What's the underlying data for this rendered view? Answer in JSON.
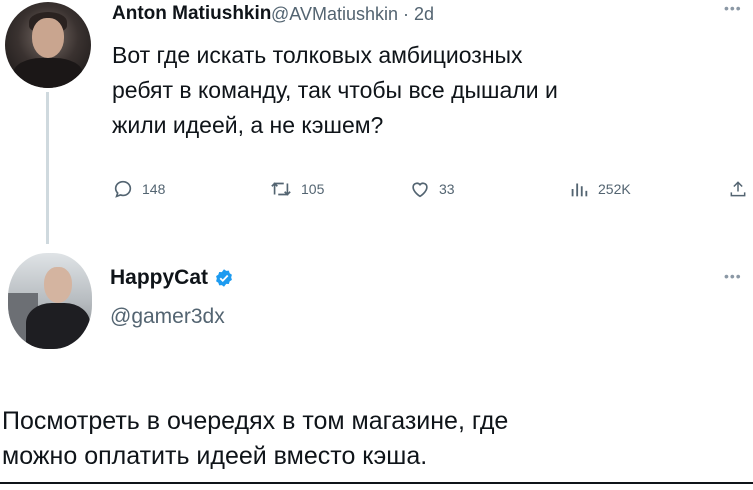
{
  "tweet": {
    "author_name": "Anton Matiushkin",
    "handle_time": "@AVMatiushkin · 2d",
    "text": "Вот где искать толковых амбициозных\nребят в команду, так чтобы все дышали и\nжили идеей, а не кэшем?",
    "replies": "148",
    "retweets": "105",
    "likes": "33",
    "views": "252K"
  },
  "reply": {
    "author_name": "HappyCat",
    "handle": "@gamer3dx",
    "text": "Посмотреть в очередях в том магазине, где\nможно оплатить идеей вместо кэша."
  },
  "icons": {
    "more": "more-dots-icon",
    "reply": "reply-icon",
    "retweet": "retweet-icon",
    "like": "heart-icon",
    "views": "views-icon",
    "share": "share-icon",
    "verified": "verified-badge-icon"
  },
  "colors": {
    "text": "#0f1419",
    "secondary": "#536471",
    "verified": "#1d9bf0",
    "thread_line": "#cfd9de"
  }
}
